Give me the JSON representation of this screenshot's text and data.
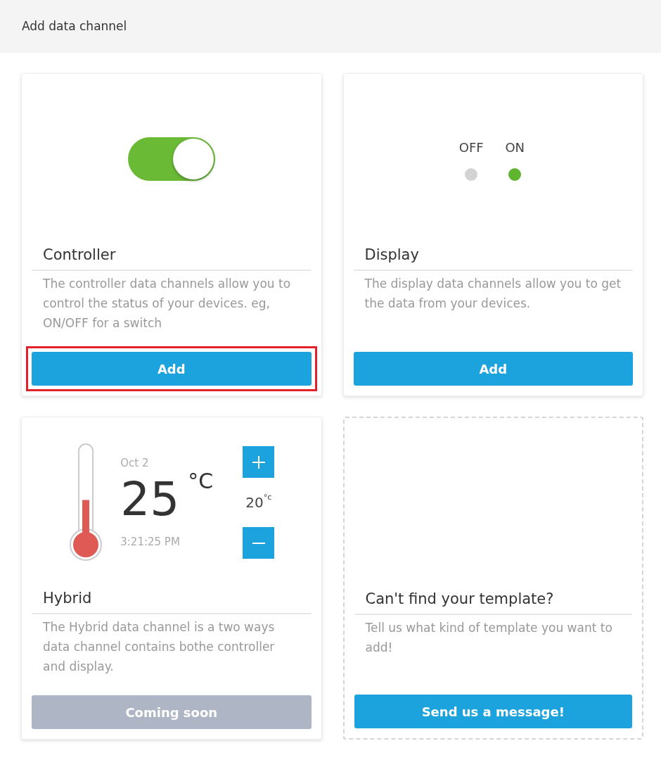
{
  "header": {
    "title": "Add data channel"
  },
  "cards": [
    {
      "kind": "controller",
      "preview": {
        "on": true
      },
      "title": "Controller",
      "description": "The controller data channels allow you to control the status of your devices. eg, ON/OFF for a switch",
      "button": {
        "label": "Add",
        "disabled": false,
        "highlighted": true
      }
    },
    {
      "kind": "display",
      "preview": {
        "indicators": [
          {
            "label": "OFF",
            "on": false
          },
          {
            "label": "ON",
            "on": true
          }
        ]
      },
      "title": "Display",
      "description": "The display data channels allow you to get the data from your devices.",
      "button": {
        "label": "Add",
        "disabled": false,
        "highlighted": false
      }
    },
    {
      "kind": "hybrid",
      "preview": {
        "level": 0.45,
        "date": "Oct 2",
        "temperature": "25",
        "unit": "°C",
        "time": "3:21:25 PM",
        "setpoint": "20",
        "setpoint_unit": "°c"
      },
      "title": "Hybrid",
      "description": "The Hybrid data channel is a two ways data channel contains bothe controller and display.",
      "button": {
        "label": "Coming soon",
        "disabled": true,
        "highlighted": false
      }
    },
    {
      "kind": "custom",
      "title": "Can't find your template?",
      "description": "Tell us what kind of template you want to add!",
      "button": {
        "label": "Send us a message!",
        "disabled": false,
        "highlighted": false
      }
    }
  ]
}
